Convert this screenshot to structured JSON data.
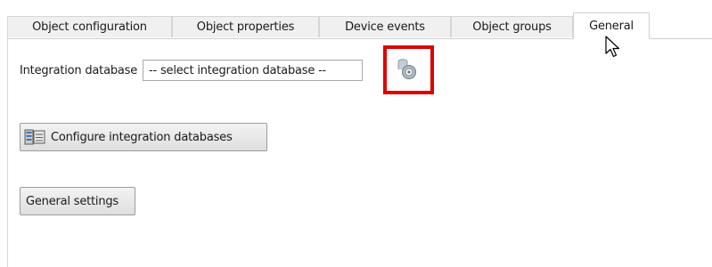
{
  "tabs": [
    {
      "label": "Object configuration"
    },
    {
      "label": "Object properties"
    },
    {
      "label": "Device events"
    },
    {
      "label": "Object groups"
    },
    {
      "label": "General",
      "active": true
    }
  ],
  "integration": {
    "label": "Integration database",
    "selected": "-- select integration database --",
    "icon": "database-connect-icon"
  },
  "buttons": {
    "configure_label": "Configure integration databases",
    "configure_icon": "database-list-icon",
    "general_settings_label": "General settings"
  },
  "colors": {
    "highlight": "#e00000",
    "active_tab": "#ffffff",
    "inactive_tab": "#f0f0f0"
  }
}
